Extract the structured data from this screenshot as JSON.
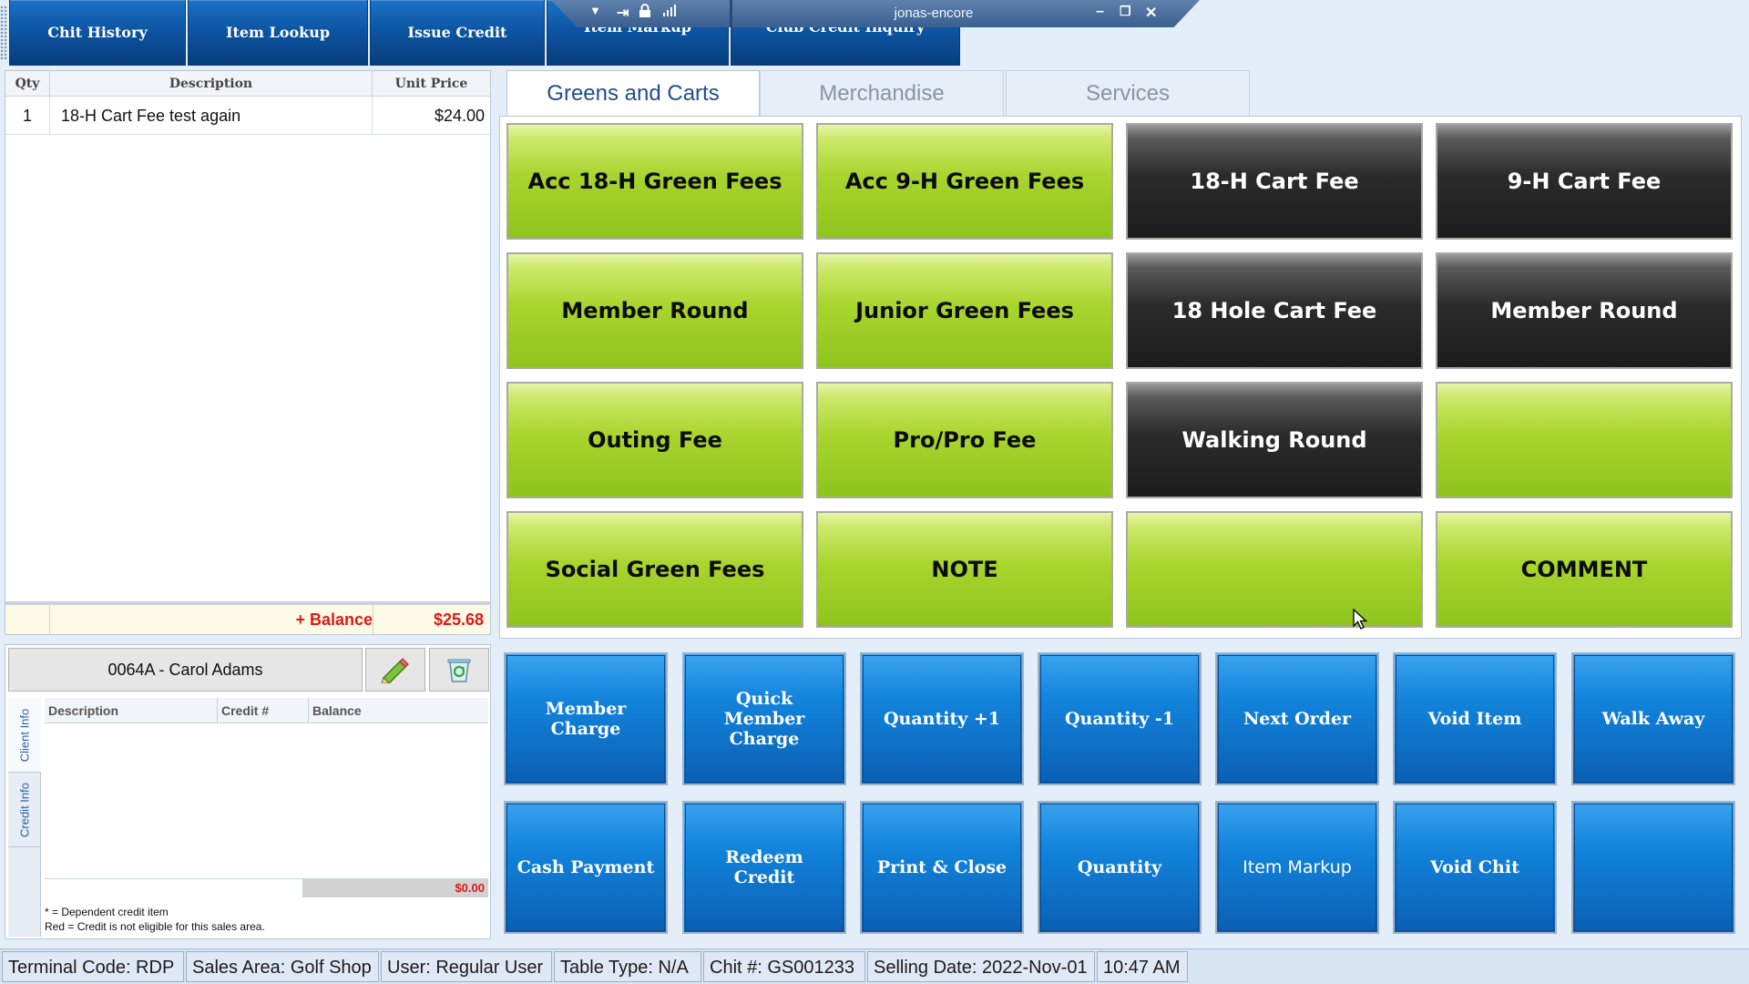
{
  "toolbar": {
    "buttons": [
      "Chit History",
      "Item Lookup",
      "Issue Credit",
      "Item Markup",
      "Club Credit Inquiry"
    ]
  },
  "rdp_bar": {
    "title": "jonas-encore"
  },
  "order": {
    "columns": [
      "Qty",
      "Description",
      "Unit Price"
    ],
    "rows": [
      {
        "qty": "1",
        "description": "18-H Cart Fee test again",
        "price": "$24.00"
      }
    ],
    "balance_label": "+ Balance",
    "balance_value": "$25.68"
  },
  "member": {
    "name": "0064A - Carol Adams",
    "side_tabs": [
      "Client Info",
      "Credit Info"
    ],
    "credit_columns": [
      "Description",
      "Credit #",
      "Balance"
    ],
    "credit_total": "$0.00",
    "notes": [
      "* = Dependent credit item",
      "Red = Credit is not eligible for this sales area."
    ]
  },
  "tabs": [
    "Greens and Carts",
    "Merchandise",
    "Services"
  ],
  "items": [
    {
      "label": "Acc 18-H Green Fees",
      "style": "green"
    },
    {
      "label": "Acc 9-H Green Fees",
      "style": "green"
    },
    {
      "label": "18-H Cart Fee",
      "style": "dark"
    },
    {
      "label": "9-H Cart Fee",
      "style": "dark"
    },
    {
      "label": "Member Round",
      "style": "green"
    },
    {
      "label": "Junior Green Fees",
      "style": "green"
    },
    {
      "label": "18 Hole Cart Fee",
      "style": "dark"
    },
    {
      "label": "Member Round",
      "style": "dark"
    },
    {
      "label": "Outing Fee",
      "style": "green"
    },
    {
      "label": "Pro/Pro Fee",
      "style": "green"
    },
    {
      "label": "Walking Round",
      "style": "dark"
    },
    {
      "label": "",
      "style": "green"
    },
    {
      "label": "Social Green Fees",
      "style": "green"
    },
    {
      "label": "NOTE",
      "style": "green"
    },
    {
      "label": "",
      "style": "green"
    },
    {
      "label": "COMMENT",
      "style": "green"
    }
  ],
  "actions": [
    "Member Charge",
    "Quick Member Charge",
    "Quantity +1",
    "Quantity -1",
    "Next Order",
    "Void Item",
    "Walk Away",
    "Cash Payment",
    "Redeem Credit",
    "Print & Close",
    "Quantity",
    "Item Markup",
    "Void Chit",
    ""
  ],
  "status": [
    "Terminal Code: RDP",
    "Sales Area: Golf Shop",
    "User: Regular User",
    "Table Type: N/A",
    "Chit #: GS001233",
    "Selling Date: 2022-Nov-01",
    "10:47 AM"
  ],
  "colors": {
    "accent_blue": "#0d56a4",
    "item_green": "#a9d52e",
    "item_dark": "#2b2b2b",
    "balance_red": "#e01818"
  }
}
